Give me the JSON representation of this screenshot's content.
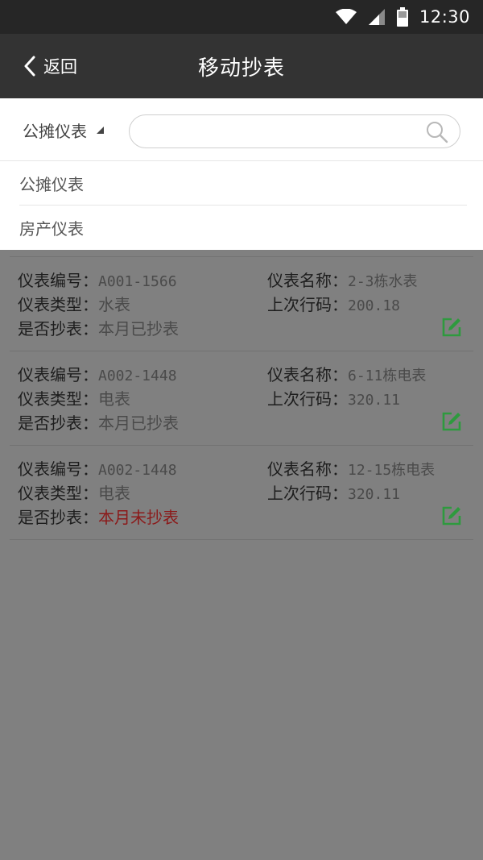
{
  "status_bar": {
    "time": "12:30"
  },
  "app_bar": {
    "back_label": "返回",
    "title": "移动抄表"
  },
  "filter": {
    "selected_type": "公摊仪表",
    "search": {
      "value": "",
      "placeholder": ""
    },
    "options": [
      {
        "label": "公摊仪表"
      },
      {
        "label": "房产仪表"
      }
    ]
  },
  "labels": {
    "meter_no": "仪表编号：",
    "meter_name": "仪表名称：",
    "meter_type": "仪表类型：",
    "last_reading": "上次行码：",
    "is_read": "是否抄表："
  },
  "meters": [
    {
      "meter_no": "A001-1566",
      "meter_name": "2-3栋水表",
      "meter_type": "水表",
      "last_reading": "200.18",
      "is_read": "本月已抄表",
      "read": true
    },
    {
      "meter_no": "A002-1448",
      "meter_name": "6-11栋电表",
      "meter_type": "电表",
      "last_reading": "320.11",
      "is_read": "本月已抄表",
      "read": true
    },
    {
      "meter_no": "A002-1448",
      "meter_name": "12-15栋电表",
      "meter_type": "电表",
      "last_reading": "320.11",
      "is_read": "本月未抄表",
      "read": false
    }
  ],
  "colors": {
    "status_bar": "#262626",
    "app_bar": "#333333",
    "overlay": "#808080",
    "edit_icon": "#2e9a3e",
    "unread_text": "#8b1a1a"
  }
}
